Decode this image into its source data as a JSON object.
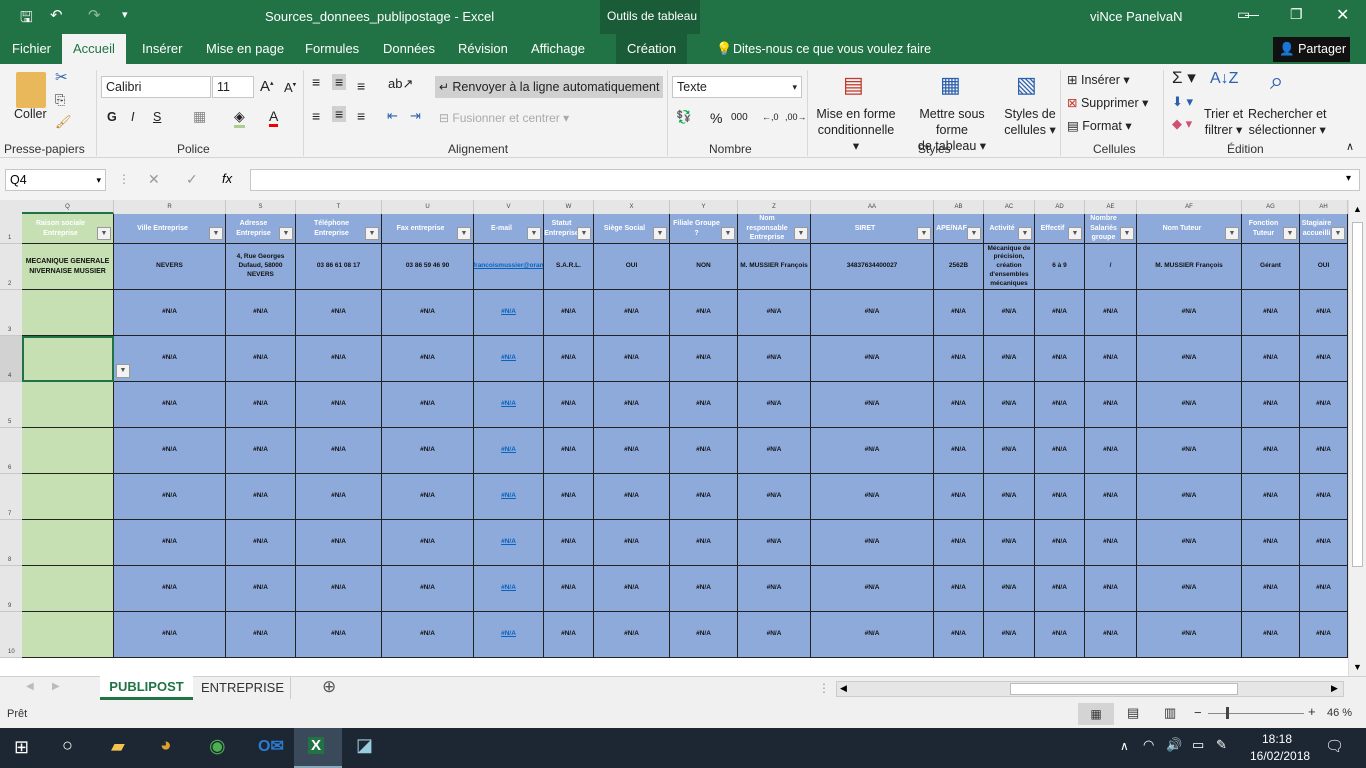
{
  "titlebar": {
    "filename": "Sources_donnees_publipostage",
    "sep": " - ",
    "app": "Excel",
    "context_tab": "Outils de tableau",
    "user": "viNce PanelvaN"
  },
  "ribbon_tabs": [
    "Fichier",
    "Accueil",
    "Insérer",
    "Mise en page",
    "Formules",
    "Données",
    "Révision",
    "Affichage",
    "Création"
  ],
  "tell_me": "Dites-nous ce que vous voulez faire",
  "share": "Partager",
  "ribbon": {
    "coller": "Coller",
    "font": "Calibri",
    "size": "11",
    "bold": "G",
    "italic": "I",
    "underline": "S",
    "wrap": "Renvoyer à la ligne automatiquement",
    "merge": "Fusionner et centrer",
    "numformat": "Texte",
    "cond": [
      "Mise en forme",
      "conditionnelle"
    ],
    "table": [
      "Mettre sous forme",
      "de tableau"
    ],
    "cellstyles": [
      "Styles de",
      "cellules"
    ],
    "insert": "Insérer",
    "delete": "Supprimer",
    "format": "Format",
    "sort": [
      "Trier et",
      "filtrer"
    ],
    "find": [
      "Rechercher et",
      "sélectionner"
    ],
    "groups": [
      "Presse-papiers",
      "Police",
      "Alignement",
      "Nombre",
      "Styles",
      "Cellules",
      "Édition"
    ]
  },
  "formula_bar": {
    "name_box": "Q4",
    "value": ""
  },
  "columns": [
    "Q",
    "R",
    "S",
    "T",
    "U",
    "V",
    "W",
    "X",
    "Y",
    "Z",
    "AA",
    "AB",
    "AC",
    "AD",
    "AE",
    "AF",
    "AG",
    "AH"
  ],
  "headers": [
    "Raison sociale Entreprise",
    "Ville Entreprise",
    "Adresse Entreprise",
    "Téléphone Entreprise",
    "Fax entreprise",
    "E-mail",
    "Statut Entreprise",
    "Siège Social",
    "Filiale Groupe ?",
    "Nom responsable Entreprise",
    "SIRET",
    "APE/NAF",
    "Activité",
    "Effectif",
    "Nombre Salariés groupe",
    "Nom Tuteur",
    "Fonction Tuteur",
    "Stagiaire accueilli"
  ],
  "rows": [
    [
      "MECANIQUE GENERALE NIVERNAISE MUSSIER",
      "NEVERS",
      "4, Rue Georges Dufaud, 58000 NEVERS",
      "03 86 61 08 17",
      "03 86 59 46 90",
      "monfrancoismussier@orange.fr",
      "S.A.R.L.",
      "OUI",
      "NON",
      "M. MUSSIER François",
      "34837634400027",
      "2562B",
      "Mécanique de précision, création d'ensembles mécaniques",
      "6 à 9",
      "/",
      "M. MUSSIER François",
      "Gérant",
      "OUI"
    ]
  ],
  "na_value": "#N/A",
  "row_numbers": [
    "1",
    "2",
    "3",
    "4",
    "5",
    "6",
    "7",
    "8",
    "9",
    "10"
  ],
  "sheets": [
    "PUBLIPOST",
    "ENTREPRISE"
  ],
  "status": {
    "ready": "Prêt",
    "zoom": "46 %"
  },
  "taskbar": {
    "time": "18:18",
    "date": "16/02/2018"
  },
  "colors": {
    "excel_green": "#217346",
    "header_blue": "#8eaadb",
    "key_green": "#c6e0b4"
  }
}
